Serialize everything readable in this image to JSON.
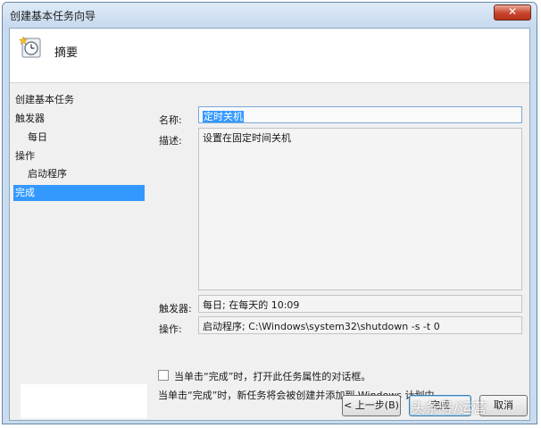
{
  "window": {
    "title": "创建基本任务向导",
    "close_label": "✕"
  },
  "header": {
    "title": "摘要",
    "icon": "task-clock-icon"
  },
  "nav": {
    "items": [
      {
        "label": "创建基本任务"
      },
      {
        "label": "触发器"
      },
      {
        "label": "每日"
      },
      {
        "label": "操作"
      },
      {
        "label": "启动程序"
      },
      {
        "label": "完成"
      }
    ]
  },
  "form": {
    "name_label": "名称:",
    "name_value": "定时关机",
    "desc_label": "描述:",
    "desc_value": "设置在固定时间关机",
    "trigger_label": "触发器:",
    "trigger_value": "每日; 在每天的 10:09",
    "action_label": "操作:",
    "action_value": "启动程序; C:\\Windows\\system32\\shutdown -s -t 0",
    "checkbox_label": "当单击“完成”时，打开此任务属性的对话框。",
    "checkbox_checked": false,
    "info_text": "当单击“完成”时，新任务将会被创建并添加到 Windows 计划中。"
  },
  "buttons": {
    "back": "< 上一步(B)",
    "finish": "完成",
    "cancel": "取消"
  },
  "watermark": "头条号/运营"
}
